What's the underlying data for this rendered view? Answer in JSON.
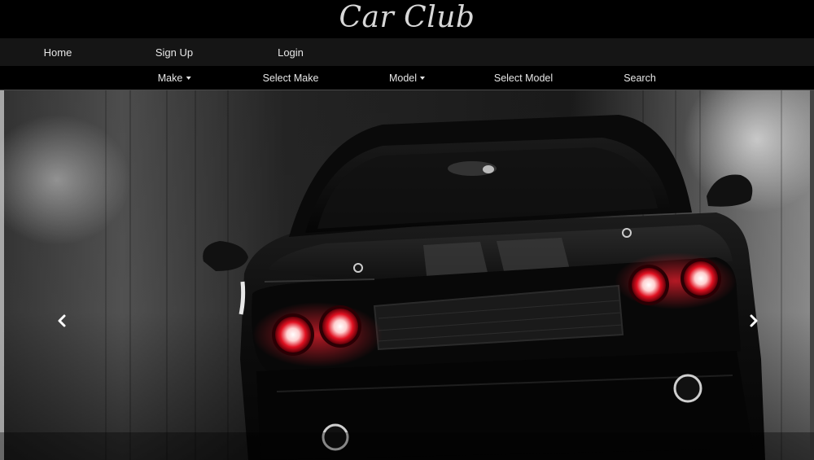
{
  "header": {
    "title": "Car Club"
  },
  "nav": {
    "items": [
      {
        "label": "Home"
      },
      {
        "label": "Sign Up"
      },
      {
        "label": "Login"
      }
    ]
  },
  "search": {
    "make_dropdown": "Make",
    "make_select": "Select Make",
    "model_dropdown": "Model",
    "model_select": "Select Model",
    "search_label": "Search"
  },
  "carousel": {
    "slide_image": "black-muscle-car-red-headlights",
    "prev_icon": "chevron-left-icon",
    "next_icon": "chevron-right-icon"
  },
  "colors": {
    "background": "#000000",
    "nav_background": "#151515",
    "text": "#e6e6e6",
    "title": "#d8d8d8",
    "headlight_red": "#e01020"
  }
}
